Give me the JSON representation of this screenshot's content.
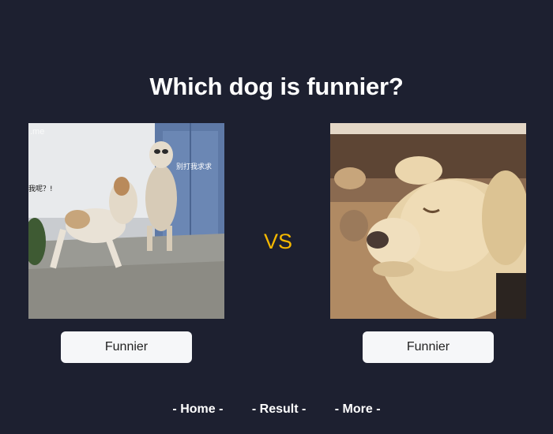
{
  "page": {
    "title": "Which dog is funnier?",
    "vs_label": "VS"
  },
  "candidates": [
    {
      "button_label": "Funnier",
      "photo_overlay_texts": [
        ".me",
        "别打我求求",
        "我呢？!"
      ]
    },
    {
      "button_label": "Funnier"
    }
  ],
  "nav": {
    "items": [
      {
        "label": "- Home -"
      },
      {
        "label": "- Result -"
      },
      {
        "label": "- More -"
      }
    ]
  },
  "colors": {
    "background": "#1d2030",
    "title": "#ffffff",
    "vs_accent": "#f5b800",
    "button_bg": "#f6f7f9",
    "button_text": "#222222"
  }
}
